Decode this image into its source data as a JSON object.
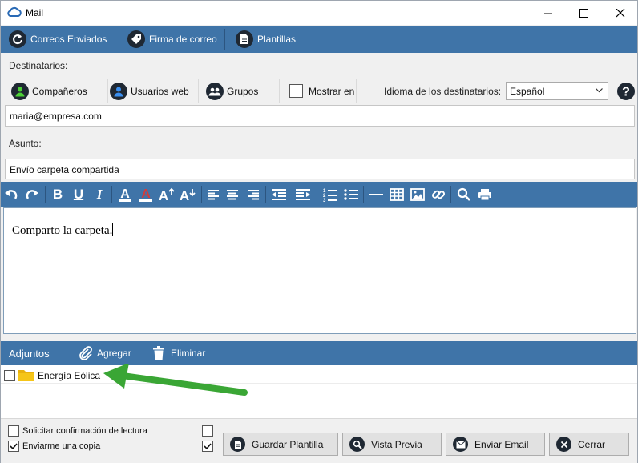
{
  "window": {
    "title": "Mail"
  },
  "toolbar": {
    "sent_label": "Correos Enviados",
    "signature_label": "Firma de correo",
    "templates_label": "Plantillas"
  },
  "recipients": {
    "label": "Destinatarios:",
    "coworkers_label": "Compañeros",
    "webusers_label": "Usuarios web",
    "groups_label": "Grupos",
    "show_label": "Mostrar en",
    "language_label": "Idioma de los destinatarios:",
    "language_value": "Español",
    "to_value": "maria@empresa.com"
  },
  "subject": {
    "label": "Asunto:",
    "value": "Envío carpeta compartida"
  },
  "editor": {
    "body_text": "Comparto la carpeta."
  },
  "attachments": {
    "label": "Adjuntos",
    "add_label": "Agregar",
    "delete_label": "Eliminar",
    "items": [
      {
        "name": "Energía Eólica",
        "type": "folder"
      }
    ]
  },
  "footer": {
    "read_receipt_label": "Solicitar confirmación de lectura",
    "copy_label": "Enviarme una copia",
    "read_receipt_checked": false,
    "copy_checked": true,
    "save_template_label": "Guardar Plantilla",
    "preview_label": "Vista Previa",
    "send_label": "Enviar Email",
    "close_label": "Cerrar"
  },
  "colors": {
    "toolbar_blue": "#3f74a8",
    "icon_dark": "#1f2833",
    "arrow_green": "#3aa635",
    "folder_yellow": "#f5c518"
  }
}
